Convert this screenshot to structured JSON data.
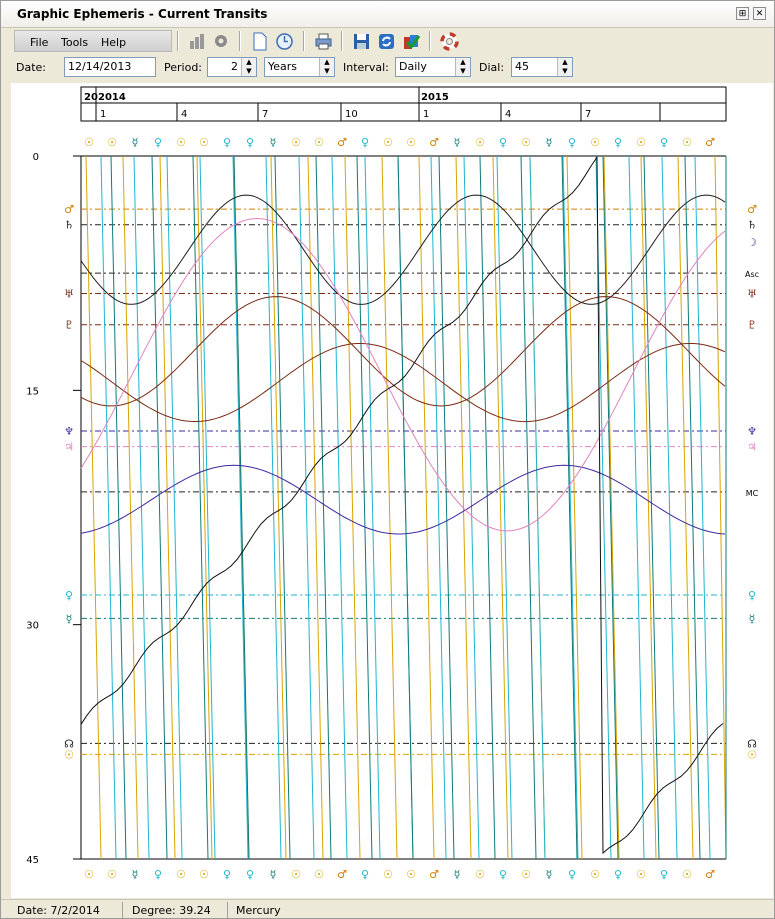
{
  "window": {
    "title": "Graphic Ephemeris - Current Transits"
  },
  "menu": {
    "file": "File",
    "tools": "Tools",
    "help": "Help"
  },
  "controls": {
    "date_label": "Date:",
    "date_value": "12/14/2013",
    "period_label": "Period:",
    "period_value": "2",
    "period_unit": "Years",
    "interval_label": "Interval:",
    "interval_value": "Daily",
    "dial_label": "Dial:",
    "dial_value": "45"
  },
  "status": {
    "date": "Date: 7/2/2014",
    "degree": "Degree: 39.24",
    "planet": "Mercury"
  },
  "colors": {
    "sun": "#d9a400",
    "moon": "#3d3d9a",
    "mercury": "#0e7a7a",
    "venus": "#1fb5d1",
    "mars": "#d08000",
    "jupiter": "#e082c0",
    "saturn": "#202020",
    "uranus": "#7a2a14",
    "neptune": "#3a2aa0",
    "pluto": "#7a2a14",
    "node": "#202020",
    "grid": "#000000"
  },
  "chart_data": {
    "type": "line",
    "title": "",
    "xlabel": "",
    "ylabel": "",
    "ylim": [
      0,
      45
    ],
    "yticks": [
      "0",
      "15",
      "30",
      "45"
    ],
    "years": [
      "20",
      "2014",
      "2015"
    ],
    "months": [
      "1",
      "4",
      "7",
      "10",
      "1",
      "4",
      "7"
    ],
    "left_markers": [
      {
        "glyph": "♂",
        "name": "mars",
        "value": 3.4
      },
      {
        "glyph": "♄",
        "name": "saturn",
        "value": 4.4
      },
      {
        "glyph": "♅",
        "name": "uranus",
        "value": 8.8
      },
      {
        "glyph": "♇",
        "name": "pluto",
        "value": 10.8
      },
      {
        "glyph": "♆",
        "name": "neptune",
        "value": 17.6
      },
      {
        "glyph": "♃",
        "name": "jupiter",
        "value": 18.6
      },
      {
        "glyph": "♀",
        "name": "venus",
        "value": 28.1
      },
      {
        "glyph": "☿",
        "name": "mercury",
        "value": 29.6
      },
      {
        "glyph": "☊",
        "name": "node",
        "value": 37.6
      },
      {
        "glyph": "☉",
        "name": "sun",
        "value": 38.3
      }
    ],
    "right_markers": [
      {
        "glyph": "♂",
        "name": "mars",
        "value": 3.4
      },
      {
        "glyph": "♄",
        "name": "saturn",
        "value": 4.4
      },
      {
        "glyph": "☽",
        "name": "moon",
        "value": 5.5
      },
      {
        "glyph": "Asc",
        "name": "ascendant",
        "value": 7.5
      },
      {
        "glyph": "♅",
        "name": "uranus",
        "value": 8.8
      },
      {
        "glyph": "♇",
        "name": "pluto",
        "value": 10.8
      },
      {
        "glyph": "♆",
        "name": "neptune",
        "value": 17.6
      },
      {
        "glyph": "♃",
        "name": "jupiter",
        "value": 18.6
      },
      {
        "glyph": "MC",
        "name": "midheaven",
        "value": 21.5
      },
      {
        "glyph": "♀",
        "name": "venus",
        "value": 28.1
      },
      {
        "glyph": "☿",
        "name": "mercury",
        "value": 29.6
      },
      {
        "glyph": "☊",
        "name": "node",
        "value": 37.6
      },
      {
        "glyph": "☉",
        "name": "sun",
        "value": 38.3
      }
    ]
  }
}
